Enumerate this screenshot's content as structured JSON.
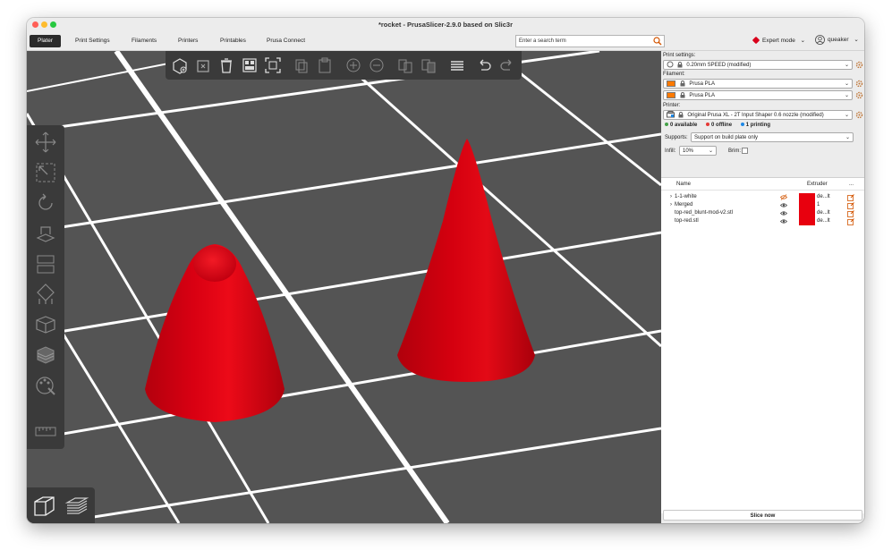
{
  "window": {
    "title": "*rocket - PrusaSlicer-2.9.0 based on Slic3r"
  },
  "tabs": [
    {
      "label": "Plater"
    },
    {
      "label": "Print Settings"
    },
    {
      "label": "Filaments"
    },
    {
      "label": "Printers"
    },
    {
      "label": "Printables"
    },
    {
      "label": "Prusa Connect"
    }
  ],
  "search": {
    "placeholder": "Enter a search term"
  },
  "mode": {
    "label": "Expert mode"
  },
  "user": {
    "name": "queaker"
  },
  "sidebar": {
    "print_settings_label": "Print settings:",
    "print_settings_value": "0.20mm SPEED (modified)",
    "filament_label": "Filament:",
    "filaments": [
      {
        "name": "Prusa PLA",
        "color": "#ff7a00"
      },
      {
        "name": "Prusa PLA",
        "color": "#ff7a00"
      }
    ],
    "printer_label": "Printer:",
    "printer_value": "Original Prusa XL - 2T Input Shaper 0.6 nozzle (modified)",
    "status": {
      "available": "0 available",
      "offline": "0 offline",
      "printing": "1 printing"
    },
    "supports_label": "Supports:",
    "supports_value": "Support on build plate only",
    "infill_label": "Infill:",
    "infill_value": "10%",
    "brim_label": "Brim:",
    "brim_checked": false
  },
  "object_list": {
    "headers": {
      "name": "Name",
      "extruder": "Extruder",
      "more": "..."
    },
    "rows": [
      {
        "name": "1-1-white",
        "extruder": "de...lt",
        "expandable": true,
        "visible": false
      },
      {
        "name": "Merged",
        "extruder": "1",
        "expandable": true,
        "visible": true
      },
      {
        "name": "top-red_blunt-mod-v2.stl",
        "extruder": "de...lt",
        "expandable": false,
        "visible": true
      },
      {
        "name": "top-red.stl",
        "extruder": "de...lt",
        "expandable": false,
        "visible": true
      }
    ]
  },
  "slice_button": {
    "label": "Slice now"
  },
  "colors": {
    "accent": "#ff7a00",
    "object_red": "#d50012",
    "bed": "#545454",
    "toolbar": "#3a3a3a",
    "expert_mode": "#d9001b",
    "offline": "#e53935",
    "available": "#43a047",
    "printing": "#1e88e5"
  },
  "icons": {
    "top_toolbar": [
      "add-icon",
      "delete-icon",
      "delete-all-icon",
      "arrange-icon",
      "arrange-selection-icon",
      "copy-icon",
      "paste-icon",
      "add-instance-icon",
      "remove-instance-icon",
      "split-objects-icon",
      "split-parts-icon",
      "layers-editing-icon",
      "undo-icon",
      "redo-icon"
    ],
    "left_toolbar": [
      "move-icon",
      "scale-icon",
      "rotate-icon",
      "place-on-face-icon",
      "cut-icon",
      "supports-paint-icon",
      "seam-paint-icon",
      "fuzzy-skin-icon",
      "mmu-paint-icon",
      "measure-icon"
    ]
  }
}
